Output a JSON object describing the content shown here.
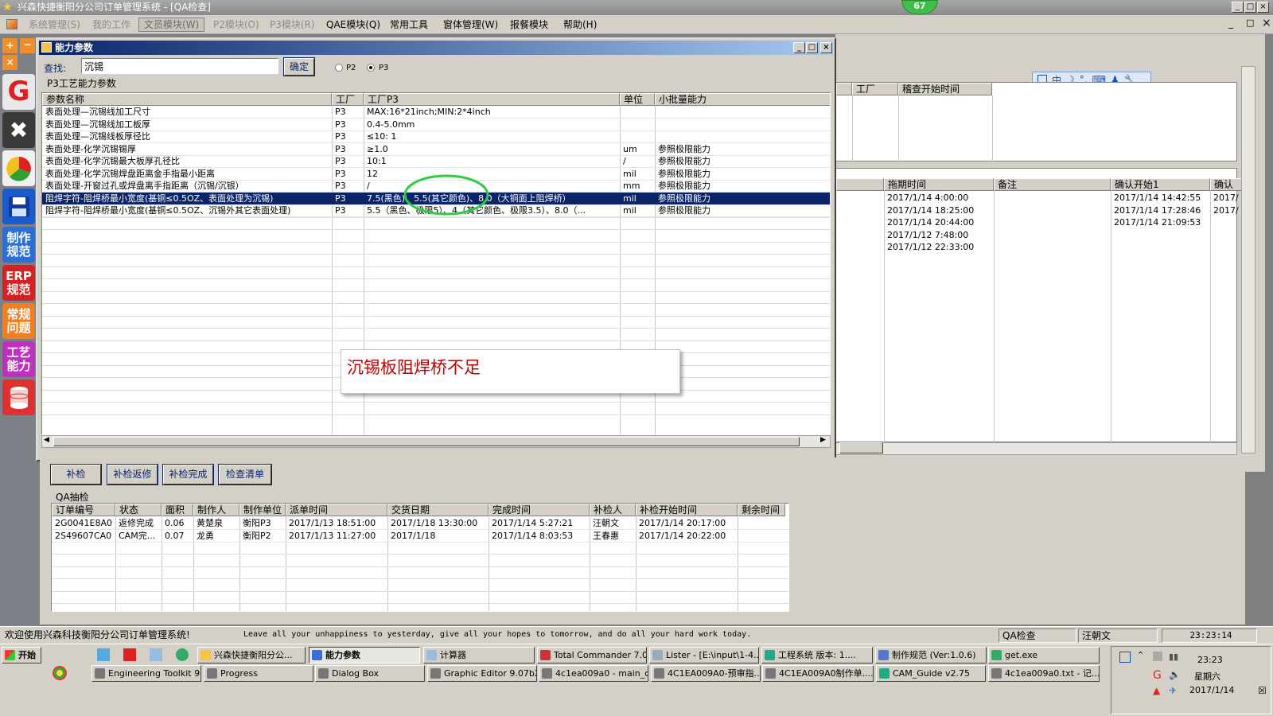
{
  "app": {
    "title": "兴森快捷衡阳分公司订单管理系统 - [QA检查]",
    "badge": "67",
    "win_min": "_",
    "win_max": "□",
    "win_close": "×"
  },
  "menu": [
    {
      "label": "系统管理(S)"
    },
    {
      "label": "我的工作"
    },
    {
      "label": "文员模块(W)"
    },
    {
      "label": "P2模块(O)"
    },
    {
      "label": "P3模块(R)"
    },
    {
      "label": "QAE模块(Q)"
    },
    {
      "label": "常用工具"
    },
    {
      "label": "窗体管理(W)"
    },
    {
      "label": "报餐模块"
    },
    {
      "label": "帮助(H)"
    }
  ],
  "left_toolbar": {
    "spec": "制作\n规范",
    "erp": "ERP\n规范",
    "common": "常规\n问题",
    "craft": "工艺\n能力"
  },
  "dialog": {
    "title": "能力参数",
    "search_label": "查找:",
    "search_value": "沉锡",
    "ok": "确定",
    "radio_p2": "P2",
    "radio_p3": "P3",
    "group_label": "P3工艺能力参数",
    "columns": [
      "参数名称",
      "工厂",
      "工厂P3",
      "单位",
      "小批量能力"
    ],
    "rows": [
      {
        "name": "表面处理—沉锡线加工尺寸",
        "factory": "P3",
        "value": "MAX:16*21inch;MIN:2*4inch",
        "unit": "",
        "capability": ""
      },
      {
        "name": "表面处理—沉锡线加工板厚",
        "factory": "P3",
        "value": "0.4-5.0mm",
        "unit": "",
        "capability": ""
      },
      {
        "name": "表面处理—沉锡线板厚径比",
        "factory": "P3",
        "value": "≤10: 1",
        "unit": "",
        "capability": ""
      },
      {
        "name": "表面处理-化学沉锡锡厚",
        "factory": "P3",
        "value": "≥1.0",
        "unit": "um",
        "capability": "参照极限能力"
      },
      {
        "name": "表面处理-化学沉锡最大板厚孔径比",
        "factory": "P3",
        "value": "10:1",
        "unit": "/",
        "capability": "参照极限能力"
      },
      {
        "name": "表面处理-化学沉锡焊盘距离金手指最小距离",
        "factory": "P3",
        "value": "12",
        "unit": "mil",
        "capability": "参照极限能力"
      },
      {
        "name": "表面处理-开窗过孔或焊盘离手指距离（沉锡/沉银）",
        "factory": "P3",
        "value": "/",
        "unit": "mm",
        "capability": "参照极限能力"
      },
      {
        "name": "阻焊字符-阻焊桥最小宽度(基铜≤0.5OZ、表面处理为沉锡)",
        "factory": "P3",
        "value": "7.5(黑色)、5.5(其它颜色)、8.0（大铜面上阻焊桥）",
        "unit": "mil",
        "capability": "参照极限能力"
      },
      {
        "name": "阻焊字符-阻焊桥最小宽度(基铜≤0.5OZ、沉锡外其它表面处理)",
        "factory": "P3",
        "value": "5.5（黑色、极限5）、4（其它颜色、极限3.5）、8.0（...",
        "unit": "mil",
        "capability": "参照极限能力"
      }
    ],
    "annotation": "沉锡板阻焊桥不足"
  },
  "right_panel": {
    "toolbar_glyphs": [
      "中",
      "☽",
      "°,",
      "⌨",
      "♟",
      "🔧"
    ],
    "top_headers": [
      "工厂",
      "稽查开始时间"
    ],
    "columns": [
      "拖期时间",
      "备注",
      "确认开始1",
      "确认"
    ],
    "rows": [
      {
        "delay": "2017/1/14 4:00:00",
        "note": "",
        "confirm1": "2017/1/14 14:42:55",
        "confirm2": "2017/"
      },
      {
        "delay": "2017/1/14 18:25:00",
        "note": "",
        "confirm1": "2017/1/14 17:28:46",
        "confirm2": "2017/"
      },
      {
        "delay": "2017/1/14 20:44:00",
        "note": "",
        "confirm1": "2017/1/14 21:09:53",
        "confirm2": ""
      },
      {
        "delay": "2017/1/12 7:48:00",
        "note": "",
        "confirm1": "",
        "confirm2": ""
      },
      {
        "delay": "2017/1/12 22:33:00",
        "note": "",
        "confirm1": "",
        "confirm2": ""
      }
    ]
  },
  "bottom": {
    "buttons": [
      "补检",
      "补检返修",
      "补检完成",
      "检查清单"
    ],
    "group_label": "QA抽检",
    "columns": [
      "订单编号",
      "状态",
      "面积",
      "制作人",
      "制作单位",
      "派单时间",
      "交货日期",
      "完成时间",
      "补检人",
      "补检开始时间",
      "剩余时间"
    ],
    "rows": [
      {
        "order": "2G0041E8A0",
        "status": "返修完成",
        "area": "0.06",
        "maker": "黄楚泉",
        "unit": "衡阳P3",
        "dispatch": "2017/1/13 18:51:00",
        "delivery": "2017/1/18 13:30:00",
        "done": "2017/1/14 5:27:21",
        "inspector": "汪朝文",
        "start": "2017/1/14 20:17:00",
        "remain": ""
      },
      {
        "order": "2S49607CA0",
        "status": "CAM完...",
        "area": "0.07",
        "maker": "龙勇",
        "unit": "衡阳P2",
        "dispatch": "2017/1/13 11:27:00",
        "delivery": "2017/1/18",
        "done": "2017/1/14 8:03:53",
        "inspector": "王春惠",
        "start": "2017/1/14 20:22:00",
        "remain": ""
      }
    ]
  },
  "status": {
    "welcome": "欢迎使用兴森科技衡阳分公司订单管理系统!",
    "motto": "Leave all your unhappiness to yesterday, give all your hopes to tomorrow, and do all your hard work today.",
    "module": "QA检查",
    "user": "汪朝文",
    "time": "23:23:14"
  },
  "taskbar": {
    "start": "开始",
    "row1": [
      "兴森快捷衡阳分公...",
      "能力参数",
      "计算器",
      "Total Commander 7.0...",
      "Lister - [E:\\input\\1-4....",
      "工程系统  版本: 1....",
      "制作规范 (Ver:1.0.6)",
      "get.exe"
    ],
    "row2": [
      "Engineering Toolkit 9....",
      "Progress",
      "Dialog Box",
      "Graphic Editor 9.07b2...",
      "4c1ea009a0 - main_qa",
      "4C1EA009A0-预审指...",
      "4C1EA009A0制作单....",
      "CAM_Guide v2.75",
      "4c1ea009a0.txt - 记..."
    ],
    "clock": "23:23",
    "weekday": "星期六",
    "date": "2017/1/14"
  },
  "colors": {
    "selection": "#0a246a",
    "annotation_text": "#c00000",
    "highlight_circle": "#2ecc40"
  }
}
